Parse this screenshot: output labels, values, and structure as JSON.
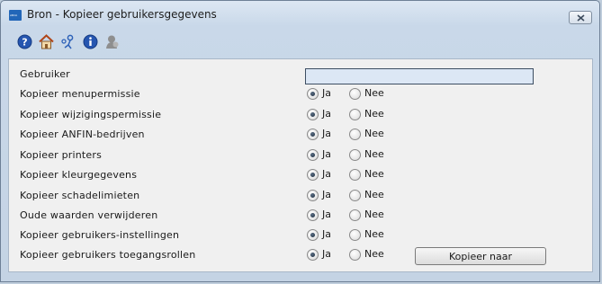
{
  "window": {
    "title": "Bron - Kopieer gebruikersgegevens",
    "app_icon_text": "ANVA"
  },
  "toolbar": {
    "icons": [
      "help-icon",
      "home-icon",
      "user-link-icon",
      "info-icon",
      "user-gray-icon"
    ]
  },
  "form": {
    "user": {
      "label": "Gebruiker",
      "value": "",
      "placeholder": ""
    },
    "options": [
      {
        "label": "Kopieer menupermissie",
        "yes": "Ja",
        "no": "Nee",
        "selected": "Ja"
      },
      {
        "label": "Kopieer wijzigingspermissie",
        "yes": "Ja",
        "no": "Nee",
        "selected": "Ja"
      },
      {
        "label": "Kopieer ANFIN-bedrijven",
        "yes": "Ja",
        "no": "Nee",
        "selected": "Ja"
      },
      {
        "label": "Kopieer printers",
        "yes": "Ja",
        "no": "Nee",
        "selected": "Ja"
      },
      {
        "label": "Kopieer kleurgegevens",
        "yes": "Ja",
        "no": "Nee",
        "selected": "Ja"
      },
      {
        "label": "Kopieer schadelimieten",
        "yes": "Ja",
        "no": "Nee",
        "selected": "Ja"
      },
      {
        "label": "Oude waarden verwijderen",
        "yes": "Ja",
        "no": "Nee",
        "selected": "Ja"
      },
      {
        "label": "Kopieer gebruikers-instellingen",
        "yes": "Ja",
        "no": "Nee",
        "selected": "Ja"
      },
      {
        "label": "Kopieer gebruikers toegangsrollen",
        "yes": "Ja",
        "no": "Nee",
        "selected": "Ja"
      }
    ],
    "submit_label": "Kopieer naar"
  },
  "colors": {
    "window_background": "#c4d3e4",
    "panel_background": "#f0f0f0",
    "input_background": "#dce7f5"
  }
}
